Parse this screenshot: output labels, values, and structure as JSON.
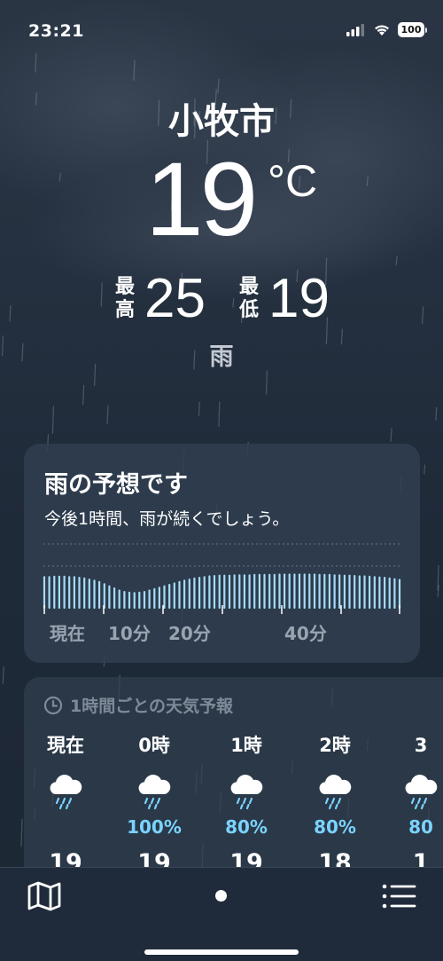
{
  "status_bar": {
    "time": "23:21",
    "battery": "100"
  },
  "weather": {
    "city": "小牧市",
    "temperature": "19",
    "unit": "°C",
    "high_label_1": "最",
    "high_label_2": "高",
    "high": "25",
    "low_label_1": "最",
    "low_label_2": "低",
    "low": "19",
    "condition": "雨"
  },
  "rain_forecast": {
    "title": "雨の予想です",
    "description": "今後1時間、雨が続くでしょう。",
    "axis_labels": [
      "現在",
      "10分",
      "20分",
      "40分"
    ],
    "intensity_levels": [
      0.92,
      0.92,
      0.93,
      0.93,
      0.93,
      0.92,
      0.92,
      0.9,
      0.88,
      0.85,
      0.82,
      0.78,
      0.72,
      0.66,
      0.6,
      0.54,
      0.5,
      0.48,
      0.47,
      0.48,
      0.5,
      0.54,
      0.58,
      0.62,
      0.66,
      0.7,
      0.74,
      0.78,
      0.82,
      0.85,
      0.88,
      0.9,
      0.92,
      0.94,
      0.95,
      0.96,
      0.96,
      0.96,
      0.97,
      0.97,
      0.97,
      0.97,
      0.98,
      0.98,
      0.98,
      0.98,
      0.98,
      0.99,
      0.99,
      0.99,
      0.99,
      0.99,
      0.99,
      0.99,
      0.99,
      0.98,
      0.98,
      0.98,
      0.97,
      0.97,
      0.96,
      0.96,
      0.95,
      0.94,
      0.94,
      0.93,
      0.92,
      0.91,
      0.9,
      0.88,
      0.86,
      0.84
    ],
    "bar_color": "#a6dcf7",
    "tick_color": "#ffffff"
  },
  "hourly": {
    "header": "1時間ごとの天気予報",
    "hours": [
      {
        "label": "現在",
        "icon": "rain-cloud-icon",
        "pct": "",
        "temp": "19"
      },
      {
        "label": "0時",
        "icon": "rain-cloud-icon",
        "pct": "100%",
        "temp": "19"
      },
      {
        "label": "1時",
        "icon": "rain-cloud-icon",
        "pct": "80%",
        "temp": "19"
      },
      {
        "label": "2時",
        "icon": "rain-cloud-icon",
        "pct": "80%",
        "temp": "18"
      },
      {
        "label": "3",
        "icon": "rain-cloud-icon",
        "pct": "80",
        "temp": "1"
      }
    ]
  },
  "colors": {
    "precip_text": "#7ad3ff",
    "card_bg": "#303e50"
  }
}
